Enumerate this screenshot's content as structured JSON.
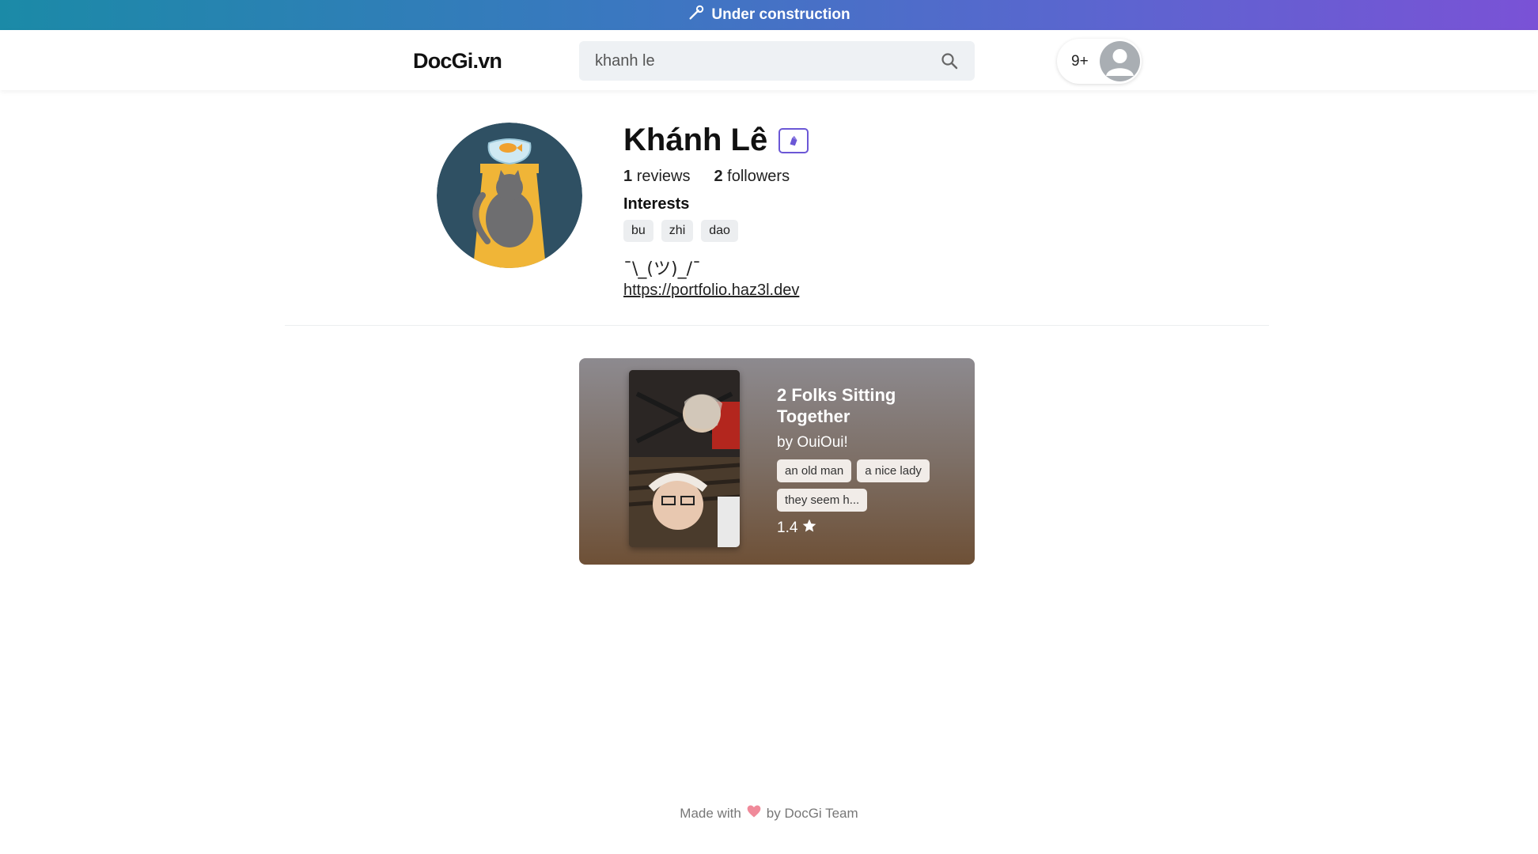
{
  "banner": {
    "text": "Under construction",
    "icon": "wrench-icon",
    "gradient": [
      "#1b8aa7",
      "#7a52d6"
    ]
  },
  "header": {
    "logo": "DocGi.vn",
    "search": {
      "value": "khanh le",
      "icon": "search-icon"
    },
    "notifications_count": "9+",
    "avatar_icon": "user-avatar-icon"
  },
  "profile": {
    "name": "Khánh Lê",
    "badge_icon": "pen-badge-icon",
    "stats": {
      "reviews_count": "1",
      "reviews_label": "reviews",
      "followers_count": "2",
      "followers_label": "followers"
    },
    "interests_label": "Interests",
    "interests": [
      "bu",
      "zhi",
      "dao"
    ],
    "bio": "¯\\_(ツ)_/¯",
    "link": "https://portfolio.haz3l.dev"
  },
  "reviews": [
    {
      "title": "2 Folks Sitting Together",
      "author": "by OuiOui!",
      "tags": [
        "an old man",
        "a nice lady",
        "they seem h..."
      ],
      "rating": "1.4",
      "rating_icon": "star-icon"
    }
  ],
  "footer": {
    "prefix": "Made with",
    "heart_icon": "heart-icon",
    "suffix": "by DocGi Team"
  },
  "colors": {
    "accent": "#6b57d6",
    "heart": "#f08a9a"
  }
}
